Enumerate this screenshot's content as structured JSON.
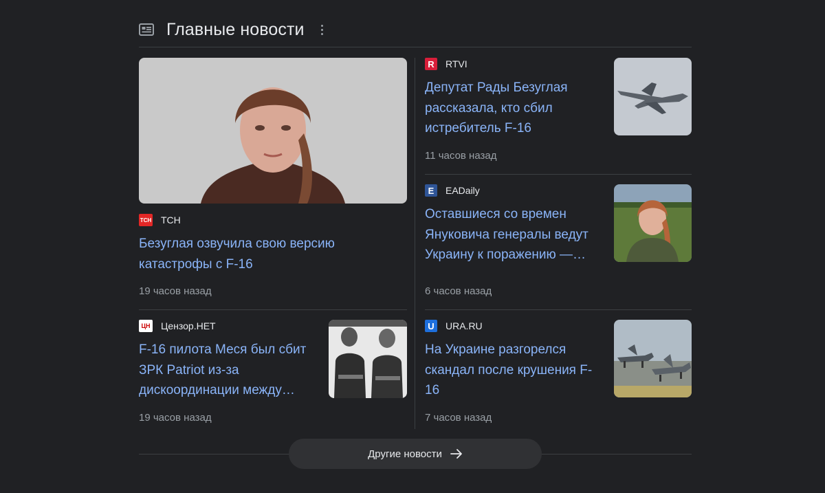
{
  "header": {
    "title": "Главные новости",
    "icon": "news-icon",
    "more_icon": "more-vert-icon"
  },
  "articles": [
    {
      "source": "TCH",
      "logo_text": "TCH",
      "logo_color": "#e32726",
      "headline": "Безуглая озвучила свою версию катастрофы с F-16",
      "time": "19 часов назад"
    },
    {
      "source": "RTVI",
      "logo_text": "R",
      "logo_color": "#d81e3a",
      "headline": "Депутат Рады Безуглая рассказала, кто сбил истребитель F-16",
      "time": "11 часов назад"
    },
    {
      "source": "EADaily",
      "logo_text": "E",
      "logo_color": "#2f5597",
      "headline": "Оставшиеся со времен Януковича генералы ведут Украину к поражению —…",
      "time": "6 часов назад"
    },
    {
      "source": "Цензор.НЕТ",
      "logo_text": "ЦН",
      "logo_color": "#ffffff",
      "headline": "F-16 пилота Меся был сбит ЗРК Patriot из-за дискоординации между…",
      "time": "19 часов назад"
    },
    {
      "source": "URA.RU",
      "logo_text": "U",
      "logo_color": "#1e6fdc",
      "headline": "На Украине разгорелся скандал после крушения F-16",
      "time": "7 часов назад"
    }
  ],
  "more_button": {
    "label": "Другие новости",
    "icon": "arrow-right-icon"
  }
}
